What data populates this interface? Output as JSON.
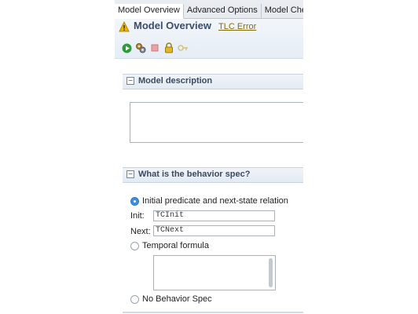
{
  "tabs": [
    {
      "label": "Model Overview",
      "active": true
    },
    {
      "label": "Advanced Options",
      "active": false
    },
    {
      "label": "Model Checking",
      "active": false
    }
  ],
  "header": {
    "title": "Model Overview",
    "tlc_link": "TLC Error",
    "warning_icon": "warning-icon"
  },
  "toolbar": {
    "icons": [
      "run-icon",
      "run-options-icon",
      "stop-icon",
      "lock-icon",
      "key-icon"
    ]
  },
  "sections": {
    "model_description": {
      "title": "Model description",
      "toggle": "−",
      "value": ""
    },
    "behavior_spec": {
      "title": "What is the behavior spec?",
      "toggle": "−",
      "options": {
        "init_next": "Initial predicate and next-state relation",
        "temporal": "Temporal formula",
        "none": "No Behavior Spec"
      },
      "selected": "init_next",
      "init_label": "Init:",
      "init_value": "TCInit",
      "next_label": "Next:",
      "next_value": "TCNext",
      "temporal_value": ""
    }
  },
  "colors": {
    "accent": "#3b8fe3",
    "title": "#3a4d6a",
    "link": "#8a6a00"
  }
}
